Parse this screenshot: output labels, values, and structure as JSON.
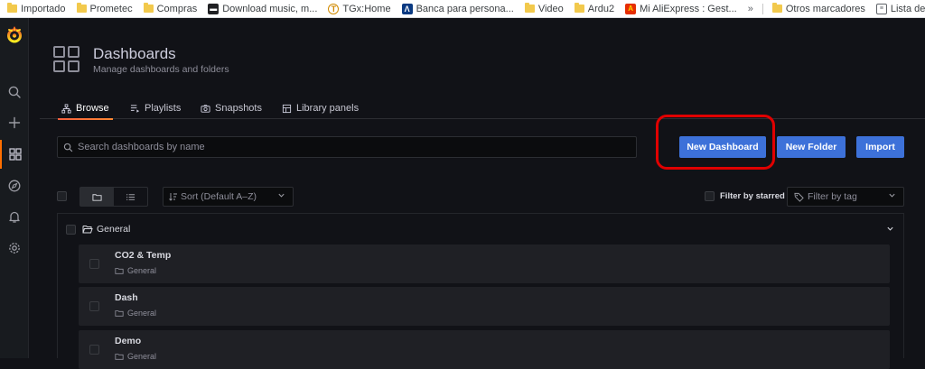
{
  "bookmarks": [
    {
      "label": "Importado",
      "icon": "folder-icon"
    },
    {
      "label": "Prometec",
      "icon": "folder-icon"
    },
    {
      "label": "Compras",
      "icon": "folder-icon"
    },
    {
      "label": "Download music, m...",
      "icon": "car-icon"
    },
    {
      "label": "TGx:Home",
      "icon": "site-icon"
    },
    {
      "label": "Banca para persona...",
      "icon": "bank-icon"
    },
    {
      "label": "Video",
      "icon": "folder-icon"
    },
    {
      "label": "Ardu2",
      "icon": "folder-icon"
    },
    {
      "label": "Mi AliExpress : Gest...",
      "icon": "aliexpress-icon"
    }
  ],
  "bookmarks_more": "»",
  "bookmarks_right": [
    {
      "label": "Otros marcadores",
      "icon": "folder-icon"
    },
    {
      "label": "Lista de lectura",
      "icon": "reading-list-icon"
    }
  ],
  "sidebar": {
    "items": [
      "search-icon",
      "plus-icon",
      "dashboards-icon",
      "explore-icon",
      "alerting-icon",
      "settings-icon"
    ],
    "active": "dashboards-icon",
    "accent": "#ff6f00"
  },
  "header": {
    "title": "Dashboards",
    "subtitle": "Manage dashboards and folders"
  },
  "tabs": [
    {
      "label": "Browse",
      "icon": "sitemap-icon",
      "active": true
    },
    {
      "label": "Playlists",
      "icon": "playlist-icon",
      "active": false
    },
    {
      "label": "Snapshots",
      "icon": "camera-icon",
      "active": false
    },
    {
      "label": "Library panels",
      "icon": "library-icon",
      "active": false
    }
  ],
  "search": {
    "placeholder": "Search dashboards by name"
  },
  "actions": {
    "new_dashboard": "New Dashboard",
    "new_folder": "New Folder",
    "import": "Import"
  },
  "filters": {
    "sort_label": "Sort (Default A–Z)",
    "starred_label": "Filter by starred",
    "tag_placeholder": "Filter by tag"
  },
  "folder": {
    "name": "General",
    "rows": [
      {
        "title": "CO2 & Temp",
        "folder": "General"
      },
      {
        "title": "Dash",
        "folder": "General"
      },
      {
        "title": "Demo",
        "folder": "General"
      }
    ]
  },
  "colors": {
    "primary": "#3d71d9",
    "highlight": "#e00000",
    "background": "#111217"
  }
}
